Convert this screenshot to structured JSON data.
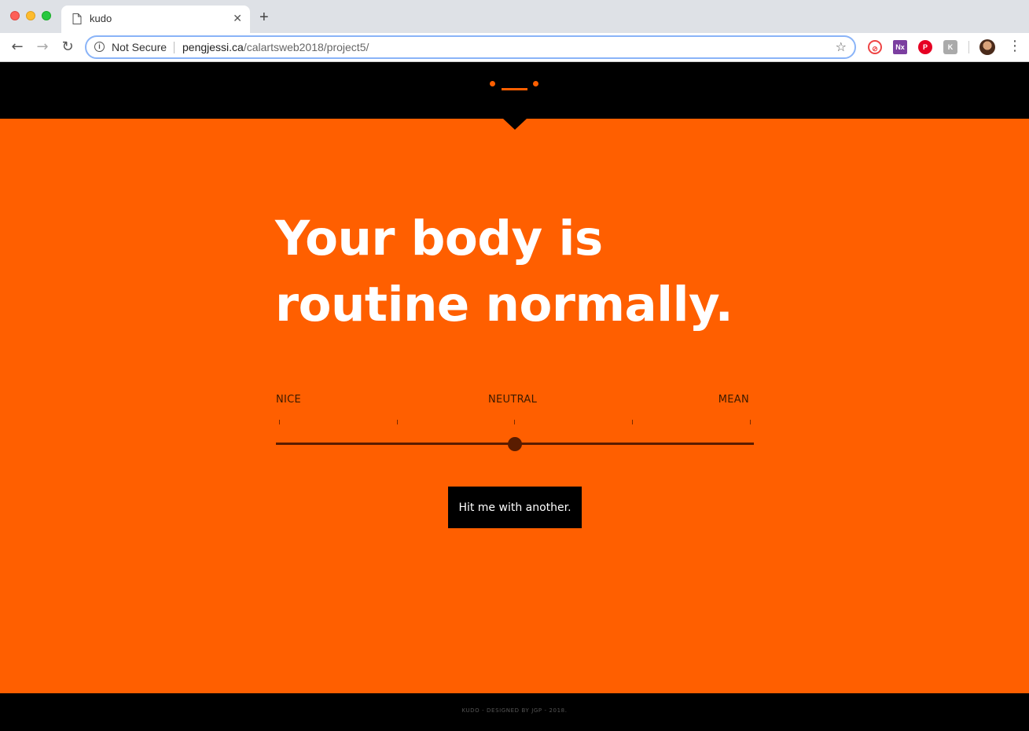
{
  "browser": {
    "tab_title": "kudo",
    "new_tab_symbol": "+",
    "close_symbol": "✕",
    "security_label": "Not Secure",
    "url_host": "pengjessi.ca",
    "url_path": "/calartsweb2018/project5/",
    "extensions": [
      "Nx"
    ]
  },
  "header": {
    "logo": "kudo-face-logo"
  },
  "main": {
    "headline_line1": "Your body is",
    "headline_line2": "routine normally.",
    "scale": {
      "left_label": "NICE",
      "center_label": "NEUTRAL",
      "right_label": "MEAN",
      "tick_count": 5,
      "value": 0.5
    },
    "button_label": "Hit me with another."
  },
  "footer": {
    "text": "KUDO - DESIGNED BY JGP - 2018."
  },
  "colors": {
    "accent": "#ff5f00",
    "dark": "#000000",
    "slider": "#5a1c00"
  }
}
